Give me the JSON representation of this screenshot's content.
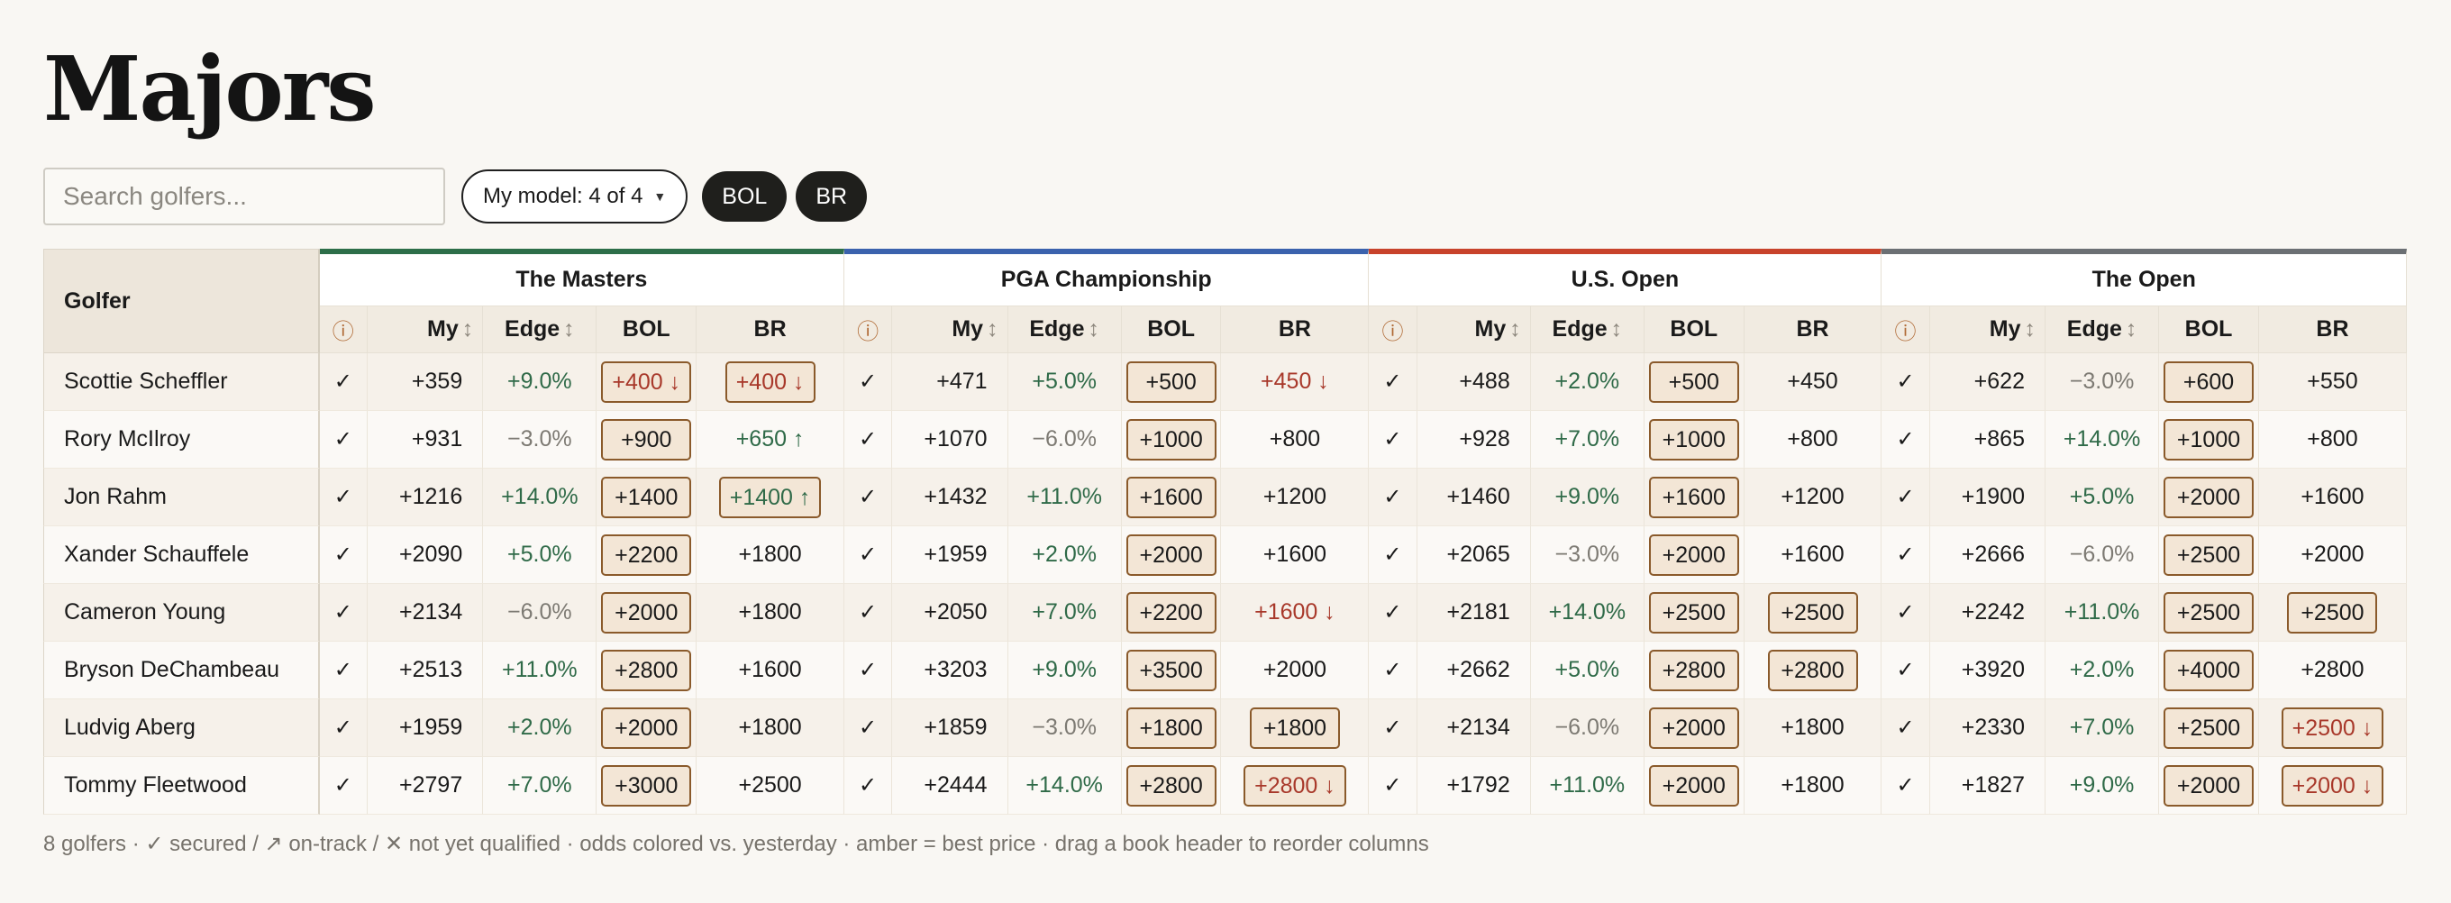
{
  "page": {
    "title": "Majors"
  },
  "toolbar": {
    "search_placeholder": "Search golfers...",
    "model_select": "My model: 4 of 4",
    "books": [
      "BOL",
      "BR"
    ]
  },
  "table": {
    "golfer_header": "Golfer",
    "sub_headers": {
      "info": "ⓘ",
      "my": "My",
      "edge": "Edge",
      "bol": "BOL",
      "br": "BR",
      "sort": "↕"
    },
    "majors": [
      {
        "name": "The Masters",
        "color": "#2d6e49"
      },
      {
        "name": "PGA Championship",
        "color": "#3b62ad"
      },
      {
        "name": "U.S. Open",
        "color": "#c8432b"
      },
      {
        "name": "The Open",
        "color": "#6c7074"
      }
    ],
    "rows": [
      {
        "golfer": "Scottie Scheffler",
        "cells": [
          {
            "status": "✓",
            "my": "+359",
            "edge": "+9.0%",
            "bol": "+400 ↓",
            "bol_best": true,
            "bol_dir": "down",
            "br": "+400 ↓",
            "br_best": true,
            "br_dir": "down"
          },
          {
            "status": "✓",
            "my": "+471",
            "edge": "+5.0%",
            "bol": "+500",
            "bol_best": true,
            "bol_dir": "",
            "br": "+450 ↓",
            "br_best": false,
            "br_dir": "down"
          },
          {
            "status": "✓",
            "my": "+488",
            "edge": "+2.0%",
            "bol": "+500",
            "bol_best": true,
            "bol_dir": "",
            "br": "+450",
            "br_best": false,
            "br_dir": ""
          },
          {
            "status": "✓",
            "my": "+622",
            "edge": "−3.0%",
            "bol": "+600",
            "bol_best": true,
            "bol_dir": "",
            "br": "+550",
            "br_best": false,
            "br_dir": ""
          }
        ]
      },
      {
        "golfer": "Rory McIlroy",
        "cells": [
          {
            "status": "✓",
            "my": "+931",
            "edge": "−3.0%",
            "bol": "+900",
            "bol_best": true,
            "bol_dir": "",
            "br": "+650 ↑",
            "br_best": false,
            "br_dir": "up"
          },
          {
            "status": "✓",
            "my": "+1070",
            "edge": "−6.0%",
            "bol": "+1000",
            "bol_best": true,
            "bol_dir": "",
            "br": "+800",
            "br_best": false,
            "br_dir": ""
          },
          {
            "status": "✓",
            "my": "+928",
            "edge": "+7.0%",
            "bol": "+1000",
            "bol_best": true,
            "bol_dir": "",
            "br": "+800",
            "br_best": false,
            "br_dir": ""
          },
          {
            "status": "✓",
            "my": "+865",
            "edge": "+14.0%",
            "bol": "+1000",
            "bol_best": true,
            "bol_dir": "",
            "br": "+800",
            "br_best": false,
            "br_dir": ""
          }
        ]
      },
      {
        "golfer": "Jon Rahm",
        "cells": [
          {
            "status": "✓",
            "my": "+1216",
            "edge": "+14.0%",
            "bol": "+1400",
            "bol_best": true,
            "bol_dir": "",
            "br": "+1400 ↑",
            "br_best": true,
            "br_dir": "up"
          },
          {
            "status": "✓",
            "my": "+1432",
            "edge": "+11.0%",
            "bol": "+1600",
            "bol_best": true,
            "bol_dir": "",
            "br": "+1200",
            "br_best": false,
            "br_dir": ""
          },
          {
            "status": "✓",
            "my": "+1460",
            "edge": "+9.0%",
            "bol": "+1600",
            "bol_best": true,
            "bol_dir": "",
            "br": "+1200",
            "br_best": false,
            "br_dir": ""
          },
          {
            "status": "✓",
            "my": "+1900",
            "edge": "+5.0%",
            "bol": "+2000",
            "bol_best": true,
            "bol_dir": "",
            "br": "+1600",
            "br_best": false,
            "br_dir": ""
          }
        ]
      },
      {
        "golfer": "Xander Schauffele",
        "cells": [
          {
            "status": "✓",
            "my": "+2090",
            "edge": "+5.0%",
            "bol": "+2200",
            "bol_best": true,
            "bol_dir": "",
            "br": "+1800",
            "br_best": false,
            "br_dir": ""
          },
          {
            "status": "✓",
            "my": "+1959",
            "edge": "+2.0%",
            "bol": "+2000",
            "bol_best": true,
            "bol_dir": "",
            "br": "+1600",
            "br_best": false,
            "br_dir": ""
          },
          {
            "status": "✓",
            "my": "+2065",
            "edge": "−3.0%",
            "bol": "+2000",
            "bol_best": true,
            "bol_dir": "",
            "br": "+1600",
            "br_best": false,
            "br_dir": ""
          },
          {
            "status": "✓",
            "my": "+2666",
            "edge": "−6.0%",
            "bol": "+2500",
            "bol_best": true,
            "bol_dir": "",
            "br": "+2000",
            "br_best": false,
            "br_dir": ""
          }
        ]
      },
      {
        "golfer": "Cameron Young",
        "cells": [
          {
            "status": "✓",
            "my": "+2134",
            "edge": "−6.0%",
            "bol": "+2000",
            "bol_best": true,
            "bol_dir": "",
            "br": "+1800",
            "br_best": false,
            "br_dir": ""
          },
          {
            "status": "✓",
            "my": "+2050",
            "edge": "+7.0%",
            "bol": "+2200",
            "bol_best": true,
            "bol_dir": "",
            "br": "+1600 ↓",
            "br_best": false,
            "br_dir": "down"
          },
          {
            "status": "✓",
            "my": "+2181",
            "edge": "+14.0%",
            "bol": "+2500",
            "bol_best": true,
            "bol_dir": "",
            "br": "+2500",
            "br_best": true,
            "br_dir": ""
          },
          {
            "status": "✓",
            "my": "+2242",
            "edge": "+11.0%",
            "bol": "+2500",
            "bol_best": true,
            "bol_dir": "",
            "br": "+2500",
            "br_best": true,
            "br_dir": ""
          }
        ]
      },
      {
        "golfer": "Bryson DeChambeau",
        "cells": [
          {
            "status": "✓",
            "my": "+2513",
            "edge": "+11.0%",
            "bol": "+2800",
            "bol_best": true,
            "bol_dir": "",
            "br": "+1600",
            "br_best": false,
            "br_dir": ""
          },
          {
            "status": "✓",
            "my": "+3203",
            "edge": "+9.0%",
            "bol": "+3500",
            "bol_best": true,
            "bol_dir": "",
            "br": "+2000",
            "br_best": false,
            "br_dir": ""
          },
          {
            "status": "✓",
            "my": "+2662",
            "edge": "+5.0%",
            "bol": "+2800",
            "bol_best": true,
            "bol_dir": "",
            "br": "+2800",
            "br_best": true,
            "br_dir": ""
          },
          {
            "status": "✓",
            "my": "+3920",
            "edge": "+2.0%",
            "bol": "+4000",
            "bol_best": true,
            "bol_dir": "",
            "br": "+2800",
            "br_best": false,
            "br_dir": ""
          }
        ]
      },
      {
        "golfer": "Ludvig Aberg",
        "cells": [
          {
            "status": "✓",
            "my": "+1959",
            "edge": "+2.0%",
            "bol": "+2000",
            "bol_best": true,
            "bol_dir": "",
            "br": "+1800",
            "br_best": false,
            "br_dir": ""
          },
          {
            "status": "✓",
            "my": "+1859",
            "edge": "−3.0%",
            "bol": "+1800",
            "bol_best": true,
            "bol_dir": "",
            "br": "+1800",
            "br_best": true,
            "br_dir": ""
          },
          {
            "status": "✓",
            "my": "+2134",
            "edge": "−6.0%",
            "bol": "+2000",
            "bol_best": true,
            "bol_dir": "",
            "br": "+1800",
            "br_best": false,
            "br_dir": ""
          },
          {
            "status": "✓",
            "my": "+2330",
            "edge": "+7.0%",
            "bol": "+2500",
            "bol_best": true,
            "bol_dir": "",
            "br": "+2500 ↓",
            "br_best": true,
            "br_dir": "down"
          }
        ]
      },
      {
        "golfer": "Tommy Fleetwood",
        "cells": [
          {
            "status": "✓",
            "my": "+2797",
            "edge": "+7.0%",
            "bol": "+3000",
            "bol_best": true,
            "bol_dir": "",
            "br": "+2500",
            "br_best": false,
            "br_dir": ""
          },
          {
            "status": "✓",
            "my": "+2444",
            "edge": "+14.0%",
            "bol": "+2800",
            "bol_best": true,
            "bol_dir": "",
            "br": "+2800 ↓",
            "br_best": true,
            "br_dir": "down"
          },
          {
            "status": "✓",
            "my": "+1792",
            "edge": "+11.0%",
            "bol": "+2000",
            "bol_best": true,
            "bol_dir": "",
            "br": "+1800",
            "br_best": false,
            "br_dir": ""
          },
          {
            "status": "✓",
            "my": "+1827",
            "edge": "+9.0%",
            "bol": "+2000",
            "bol_best": true,
            "bol_dir": "",
            "br": "+2000 ↓",
            "br_best": true,
            "br_dir": "down"
          }
        ]
      }
    ]
  },
  "footnote": "8 golfers · ✓ secured / ↗ on-track / ✕ not yet qualified · odds colored vs. yesterday · amber = best price · drag a book header to reorder columns"
}
